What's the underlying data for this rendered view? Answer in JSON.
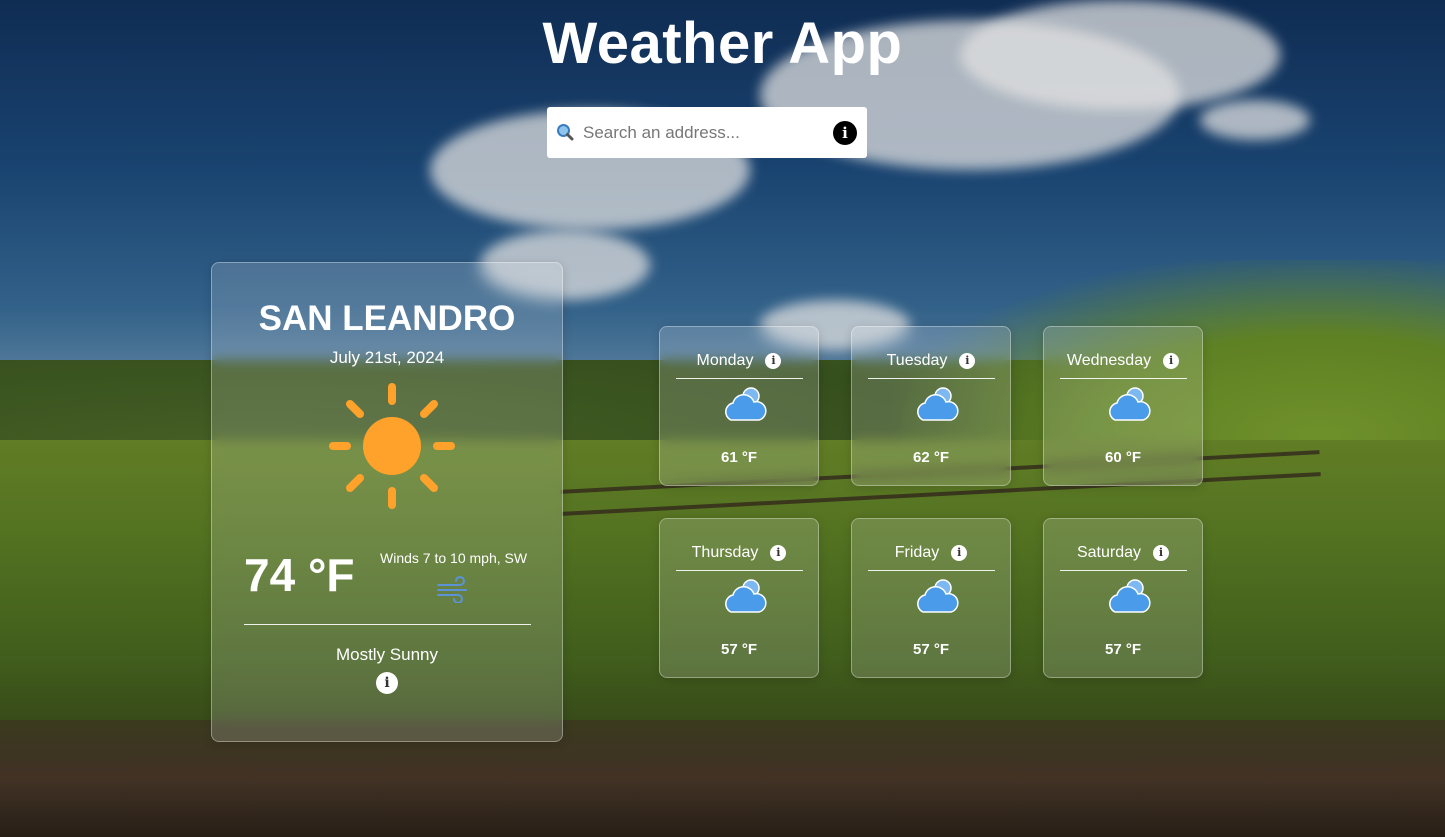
{
  "app": {
    "title": "Weather App"
  },
  "search": {
    "placeholder": "Search an address...",
    "value": ""
  },
  "current": {
    "city": "SAN LEANDRO",
    "date": "July 21st, 2024",
    "temperature": "74 °F",
    "winds": "Winds 7 to 10 mph, SW",
    "condition": "Mostly Sunny",
    "icon": "sun-icon"
  },
  "forecast": [
    {
      "day": "Monday",
      "temp": "61 °F",
      "icon": "cloud-icon"
    },
    {
      "day": "Tuesday",
      "temp": "62 °F",
      "icon": "cloud-icon"
    },
    {
      "day": "Wednesday",
      "temp": "60 °F",
      "icon": "cloud-icon"
    },
    {
      "day": "Thursday",
      "temp": "57 °F",
      "icon": "cloud-icon"
    },
    {
      "day": "Friday",
      "temp": "57 °F",
      "icon": "cloud-icon"
    },
    {
      "day": "Saturday",
      "temp": "57 °F",
      "icon": "cloud-icon"
    }
  ],
  "colors": {
    "sun": "#FFA22B",
    "cloud": "#4A9BEA",
    "wind": "#5B93D6"
  }
}
